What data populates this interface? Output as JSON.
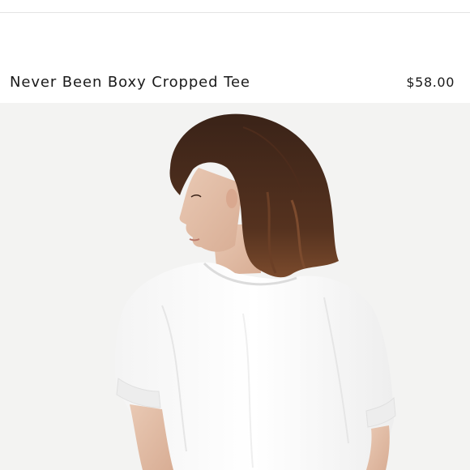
{
  "product": {
    "title": "Never Been Boxy Cropped Tee",
    "price": "$58.00"
  },
  "image": {
    "alt": "Never Been Boxy Cropped Tee",
    "background_color": "#f3f3f2"
  },
  "colors": {
    "text": "#1a1a1a",
    "divider": "#e4e4e4"
  }
}
